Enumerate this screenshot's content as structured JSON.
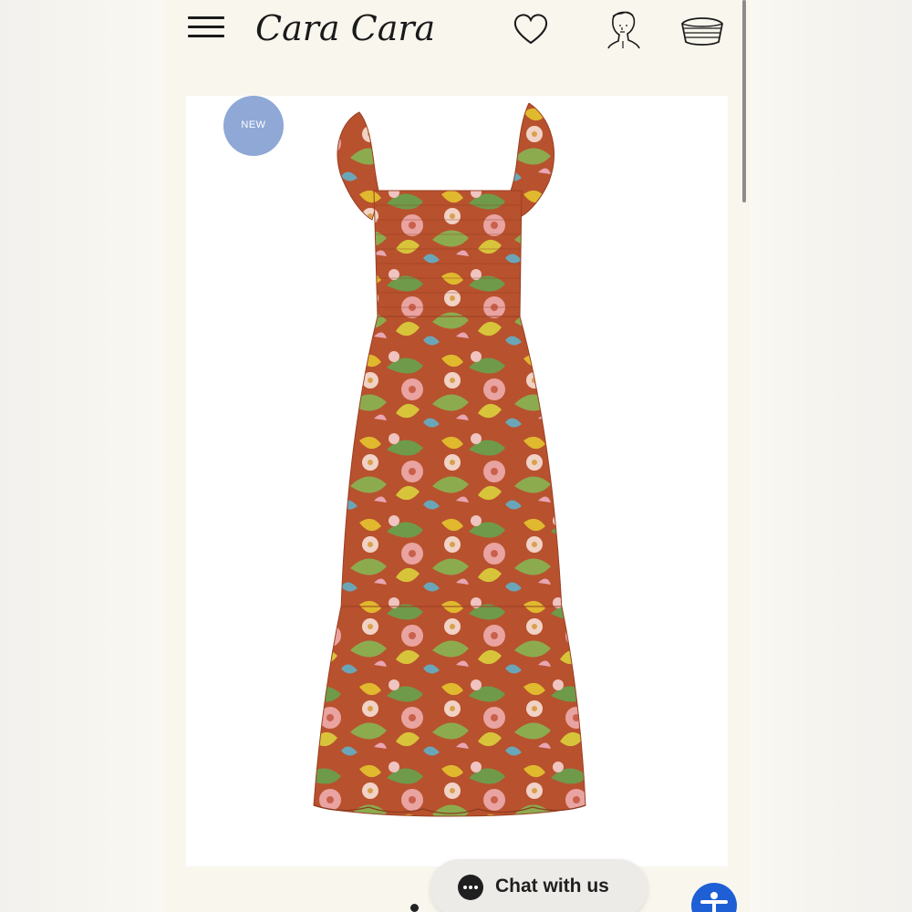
{
  "header": {
    "brand": "Cara Cara",
    "icons": [
      "menu-icon",
      "heart-icon",
      "account-bust-icon",
      "basket-icon"
    ]
  },
  "product": {
    "badge": "NEW",
    "image_subject": "floral smocked midi dress with ruffle sleeves"
  },
  "chat": {
    "label": "Chat with us",
    "icon": "chat-bubble-icon"
  },
  "accessibility": {
    "icon": "accessibility-icon"
  },
  "colors": {
    "badge": "#8fa8d6",
    "accessibility_button": "#1f5fd6",
    "page_background": "#f9f6ee",
    "dress_base": "#b8512e"
  }
}
